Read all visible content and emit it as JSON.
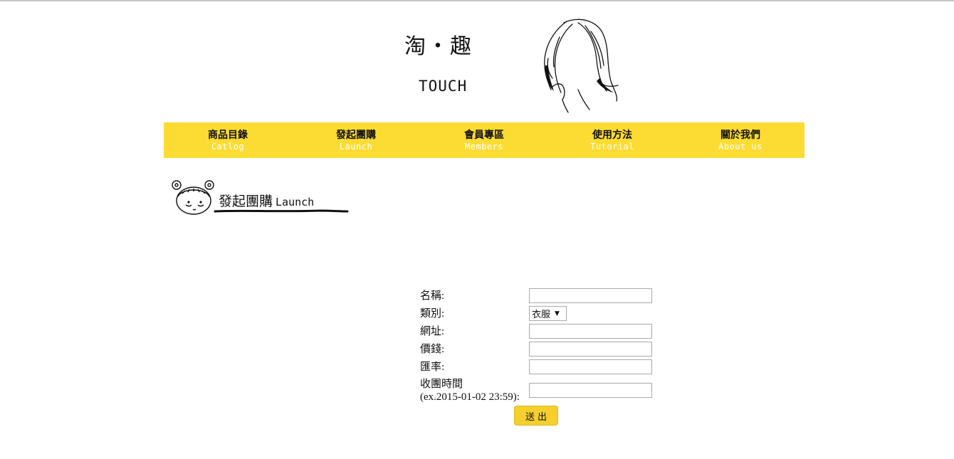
{
  "header": {
    "logo_cn": "淘・趣",
    "logo_en": "TOUCH",
    "sketch_icon": "girl-profile-sketch-icon"
  },
  "nav": {
    "items": [
      {
        "cn": "商品目錄",
        "en": "Catlog"
      },
      {
        "cn": "發起團購",
        "en": "Launch"
      },
      {
        "cn": "會員專區",
        "en": "Members"
      },
      {
        "cn": "使用方法",
        "en": "Tutorial"
      },
      {
        "cn": "關於我們",
        "en": "About us"
      }
    ],
    "bar_color": "#fcdc33"
  },
  "section": {
    "title_cn": "發起團購",
    "title_en": "Launch",
    "icon": "girl-face-icon"
  },
  "form": {
    "name_label": "名稱:",
    "category_label": "類別:",
    "category_value": "衣服",
    "url_label": "網址:",
    "price_label": "價錢:",
    "rate_label": "匯率:",
    "deadline_label": "收團時間",
    "deadline_hint": "(ex.2015-01-02 23:59):",
    "submit_label": "送出"
  }
}
